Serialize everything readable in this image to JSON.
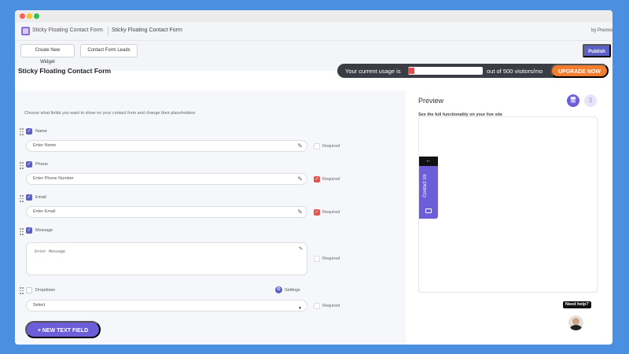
{
  "appbar": {
    "title": "Sticky Floating Contact Form",
    "page": "Sticky Floating Contact Form",
    "by": "by Premio"
  },
  "actions": {
    "create_widget": "Create New Widget",
    "form_leads": "Contact Form Leads",
    "publish": "Publish"
  },
  "header": {
    "widget_title": "Sticky Floating Contact Form"
  },
  "usage": {
    "prefix": "Your current usage is",
    "suffix": "out of 500 visitors/mo",
    "upgrade": "UPGRADE NOW"
  },
  "form": {
    "intro": "Choose what fields you want to show on your contact form and change their placeholders",
    "fields": [
      {
        "label": "Name",
        "placeholder": "Enter Name",
        "required_label": "Required"
      },
      {
        "label": "Phone",
        "placeholder": "Enter Phone Number",
        "required_label": "Required"
      },
      {
        "label": "Email",
        "placeholder": "Enter Email",
        "required_label": "Required"
      },
      {
        "label": "Message",
        "placeholder": "Enter Message",
        "required_label": "Required"
      },
      {
        "label": "Dropdown",
        "placeholder": "Select",
        "required_label": "Required",
        "settings_label": "Settings"
      }
    ],
    "add_field": "+ NEW TEXT FIELD"
  },
  "preview": {
    "title": "Preview",
    "subtitle": "See the full functionality on your live site",
    "sticky_label": "Contact Us",
    "arrow": "←"
  },
  "help": {
    "label": "Need help?",
    "close": "×"
  },
  "icons": {
    "pencil": "✎",
    "check": "✓",
    "gear": "⚙",
    "caret": "▼",
    "desktop": "🖥",
    "mobile": "▯"
  },
  "colors": {
    "accent": "#6c5ed8",
    "upgrade": "#f47c2e",
    "required_on": "#e0554f"
  }
}
